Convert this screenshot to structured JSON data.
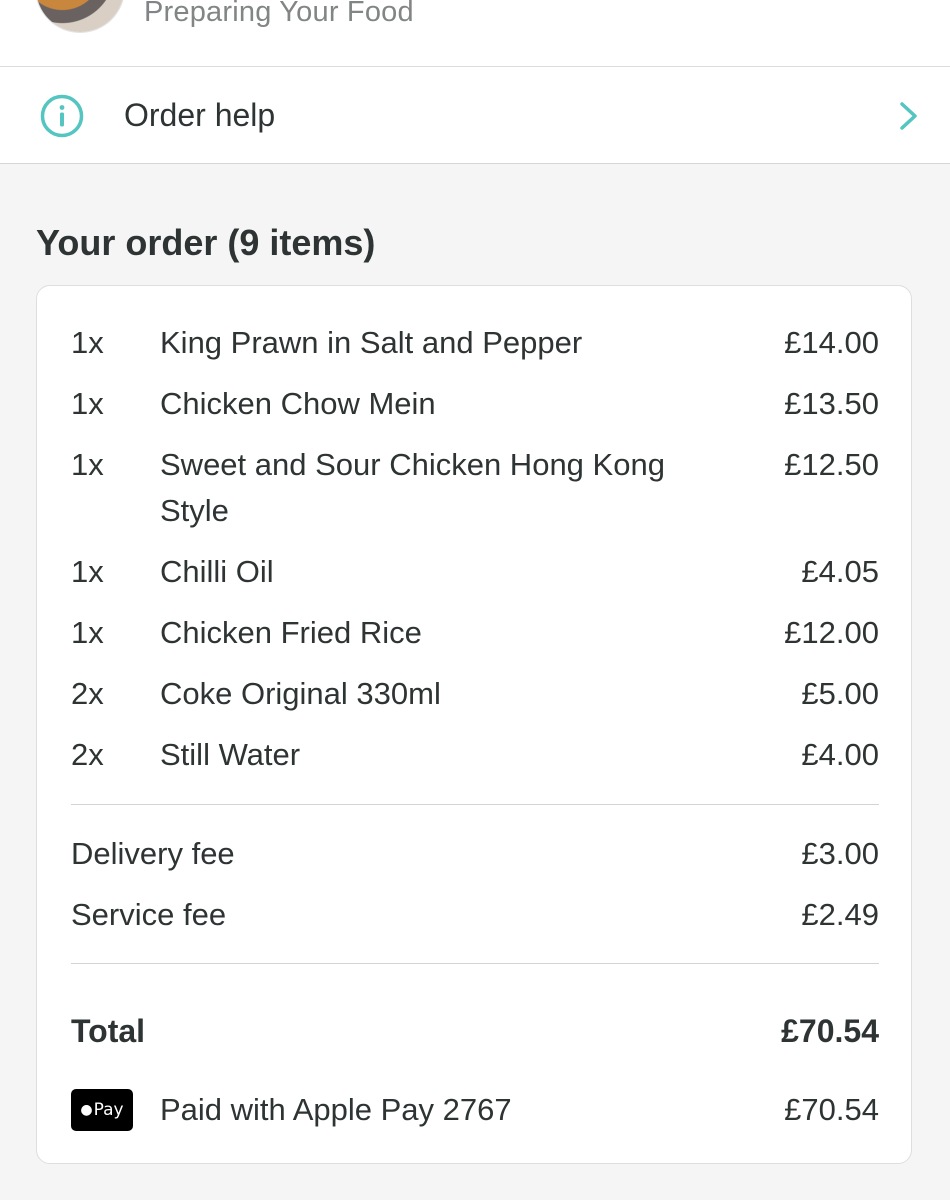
{
  "header": {
    "status_text": "Preparing Your Food"
  },
  "help": {
    "label": "Order help",
    "icon": "info-icon",
    "accent_color": "#54c5c1"
  },
  "order": {
    "title": "Your order (9 items)",
    "items": [
      {
        "qty": "1x",
        "name": "King Prawn in Salt and Pepper",
        "price": "£14.00"
      },
      {
        "qty": "1x",
        "name": "Chicken Chow Mein",
        "price": "£13.50"
      },
      {
        "qty": "1x",
        "name": "Sweet and Sour Chicken Hong Kong Style",
        "price": "£12.50"
      },
      {
        "qty": "1x",
        "name": "Chilli Oil",
        "price": "£4.05"
      },
      {
        "qty": "1x",
        "name": "Chicken Fried Rice",
        "price": "£12.00"
      },
      {
        "qty": "2x",
        "name": "Coke Original 330ml",
        "price": "£5.00"
      },
      {
        "qty": "2x",
        "name": "Still Water",
        "price": "£4.00"
      }
    ],
    "fees": [
      {
        "label": "Delivery fee",
        "amount": "£3.00"
      },
      {
        "label": "Service fee",
        "amount": "£2.49"
      }
    ],
    "total": {
      "label": "Total",
      "amount": "£70.54"
    },
    "payment": {
      "badge_text": "Pay",
      "label": "Paid with Apple Pay 2767",
      "amount": "£70.54"
    }
  }
}
